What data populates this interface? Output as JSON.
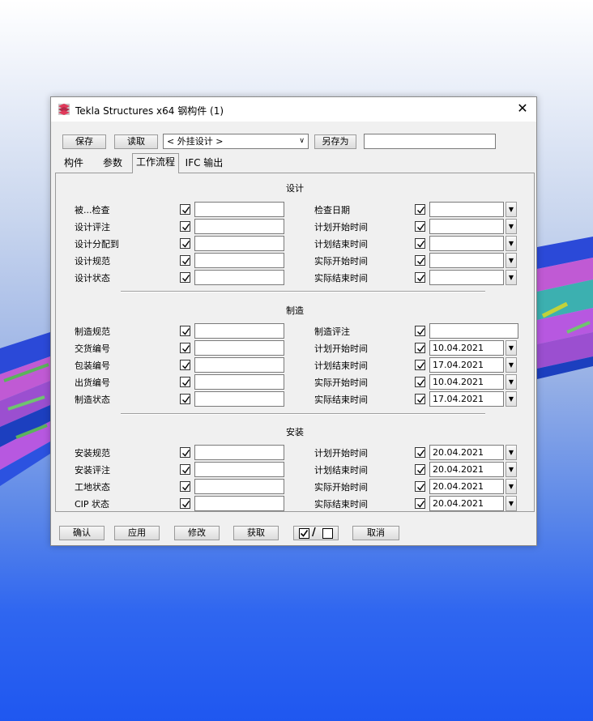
{
  "window": {
    "title": "Tekla Structures x64  钢构件 (1)",
    "close_symbol": "✕"
  },
  "toolbar": {
    "save_label": "保存",
    "load_label": "读取",
    "preset_value": "< 外挂设计 >",
    "save_as_label": "另存为",
    "save_as_name": ""
  },
  "tabs": [
    {
      "label": "构件"
    },
    {
      "label": "参数"
    },
    {
      "label": "工作流程"
    },
    {
      "label": "IFC 输出"
    }
  ],
  "sections": {
    "design": {
      "title": "设计",
      "left": [
        {
          "label": "被...检查",
          "value": ""
        },
        {
          "label": "设计评注",
          "value": ""
        },
        {
          "label": "设计分配到",
          "value": ""
        },
        {
          "label": "设计规范",
          "value": ""
        },
        {
          "label": "设计状态",
          "value": ""
        }
      ],
      "right": [
        {
          "label": "检查日期",
          "value": ""
        },
        {
          "label": "计划开始时间",
          "value": ""
        },
        {
          "label": "计划结束时间",
          "value": ""
        },
        {
          "label": "实际开始时间",
          "value": ""
        },
        {
          "label": "实际结束时间",
          "value": ""
        }
      ]
    },
    "fabrication": {
      "title": "制造",
      "left": [
        {
          "label": "制造规范",
          "value": ""
        },
        {
          "label": "交货编号",
          "value": ""
        },
        {
          "label": "包装编号",
          "value": ""
        },
        {
          "label": "出货编号",
          "value": ""
        },
        {
          "label": "制造状态",
          "value": ""
        }
      ],
      "right": [
        {
          "label": "制造评注",
          "value": ""
        },
        {
          "label": "计划开始时间",
          "value": "10.04.2021"
        },
        {
          "label": "计划结束时间",
          "value": "17.04.2021"
        },
        {
          "label": "实际开始时间",
          "value": "10.04.2021"
        },
        {
          "label": "实际结束时间",
          "value": "17.04.2021"
        }
      ]
    },
    "erection": {
      "title": "安装",
      "left": [
        {
          "label": "安装规范",
          "value": ""
        },
        {
          "label": "安装评注",
          "value": ""
        },
        {
          "label": "工地状态",
          "value": ""
        },
        {
          "label": "CIP 状态",
          "value": ""
        }
      ],
      "right": [
        {
          "label": "计划开始时间",
          "value": "20.04.2021"
        },
        {
          "label": "计划结束时间",
          "value": "20.04.2021"
        },
        {
          "label": "实际开始时间",
          "value": "20.04.2021"
        },
        {
          "label": "实际结束时间",
          "value": "20.04.2021"
        }
      ]
    }
  },
  "footer": {
    "ok_label": "确认",
    "apply_label": "应用",
    "modify_label": "修改",
    "get_label": "获取",
    "toggle_separator": "/",
    "cancel_label": "取消"
  },
  "icons": {
    "dropdown": "▼",
    "app": "tekla-logo"
  },
  "colors": {
    "accent_background": "#1f57f0",
    "dialog_bg": "#f0f0f0"
  }
}
